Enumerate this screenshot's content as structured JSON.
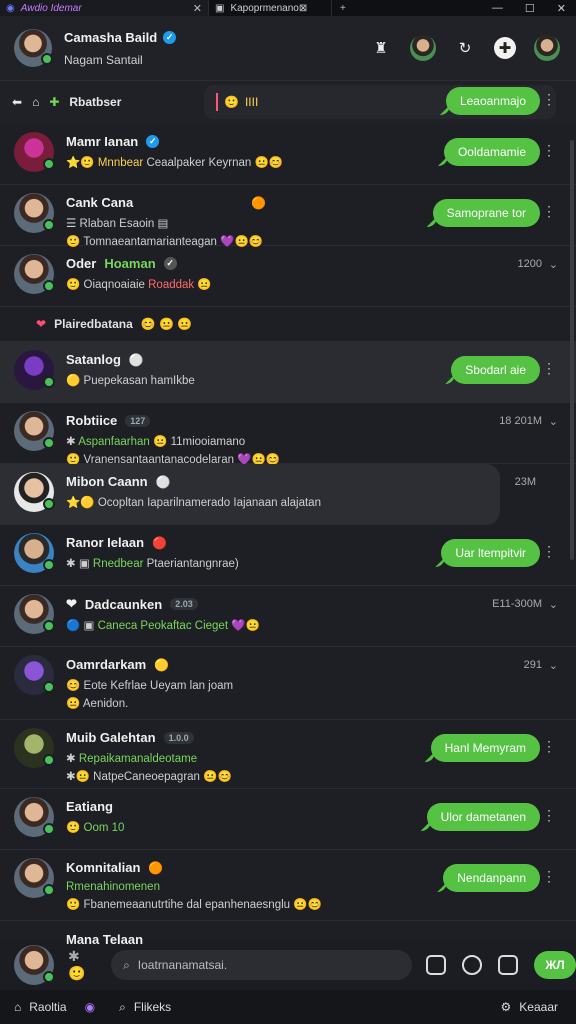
{
  "tabs": [
    {
      "title": "Awdio Idemar",
      "active": true
    },
    {
      "title": "Kapoprmenano⊠",
      "active": false
    }
  ],
  "window_controls": {
    "minimize": "—",
    "maximize": "☐",
    "close": "✕"
  },
  "header": {
    "name": "Camasha Baild",
    "subtitle": "Nagam Santail"
  },
  "pinned": {
    "label": "Rbatbser",
    "snippet": "IIII",
    "pill": "Leaoanmajo"
  },
  "chats": [
    {
      "name": "Mamr Ianan",
      "preview": "Mnnbear",
      "preview_rest": "Ceaalpaker Keyrnan",
      "pill": "Ooldamamie"
    },
    {
      "name": "Cank Cana",
      "preview": "Rlaban Esaoin",
      "preview2": "Tomnaeantamarianteagan",
      "pill": "Samoprane tor"
    },
    {
      "name": "Oder",
      "name_green": "Hoaman",
      "time": "1200",
      "preview": "Oiaqnoaiaie",
      "preview_red": "Roaddak"
    },
    {
      "mini": "Plairedbatana"
    },
    {
      "name": "Satanlog",
      "preview": "Puepekasan hamIkbe",
      "pill": "Sbodarl aie"
    },
    {
      "name": "Robtiice",
      "badge": "127",
      "time": "18 201M",
      "preview": "Aspanfaarhan",
      "preview_rest": "11miooiamano",
      "preview2": "Vranensantaantanacodelaran"
    },
    {
      "name": "Mibon Caann",
      "time": "23M",
      "preview": "Ocopltan Iaparilnamerado Iajanaan alajatan"
    },
    {
      "name": "Ranor Ielaan",
      "preview": "Rnedbear",
      "preview_rest": "Ptaeriantangnrae)",
      "pill": "Uar ltempitvir"
    },
    {
      "name": "Dadcaunken",
      "badge": "2.03",
      "time": "E11-300M",
      "preview": "Caneca Peokaftac Cieget"
    },
    {
      "name": "Oamrdarkam",
      "time": "291",
      "preview": "Eote Kefrlae Ueyam lan joam",
      "preview2": "Aenidon."
    },
    {
      "name": "Muib Galehtan",
      "badge": "1.0.0",
      "preview": "Repaikamanaldeotame",
      "preview2": "NatpeCaneoepagran",
      "pill": "Hanl Memyram"
    },
    {
      "name": "Eatiang",
      "preview": "Oom 10",
      "pill": "Ulor dametanen"
    },
    {
      "name": "Komnitalian",
      "preview": "Rmenahinomenen",
      "preview2": "Fbanemeaanutrtihe dal epanhenaesnglu",
      "pill": "Nendanpann"
    }
  ],
  "composer": {
    "name": "Mana Telaan",
    "placeholder": "Ioatrnanamatsai.",
    "send": "ЖЛ"
  },
  "bottom_nav": {
    "home": "Raoltia",
    "search": "Flikeks",
    "right": "Keaaar"
  }
}
